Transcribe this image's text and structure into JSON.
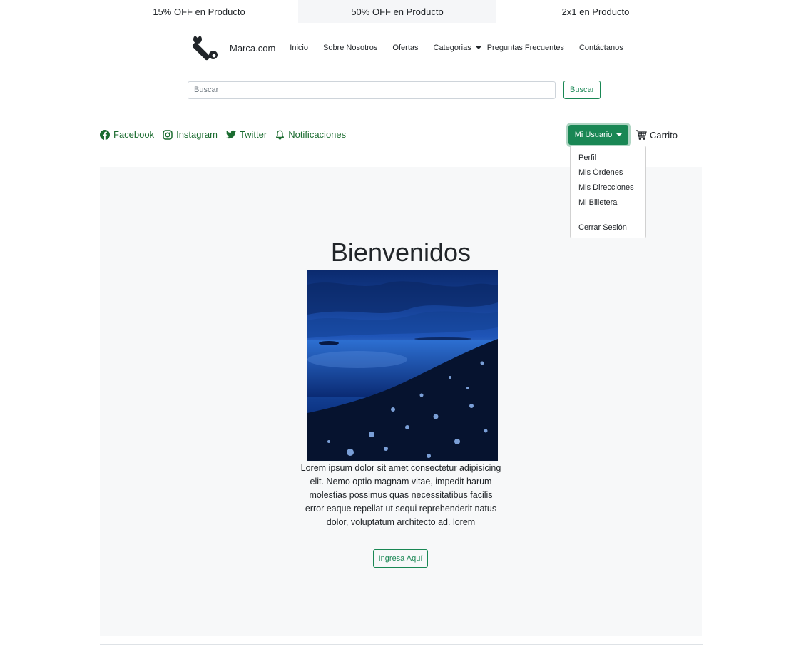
{
  "promo": {
    "items": [
      "15% OFF en Producto",
      "50% OFF en Producto",
      "2x1 en Producto"
    ]
  },
  "nav": {
    "brand": "Marca.com",
    "links": [
      "Inicio",
      "Sobre Nosotros",
      "Ofertas",
      "Categorias",
      "Preguntas Frecuentes",
      "Contáctanos"
    ]
  },
  "search": {
    "placeholder": "Buscar",
    "button": "Buscar"
  },
  "social": {
    "facebook": "Facebook",
    "instagram": "Instagram",
    "twitter": "Twitter",
    "notifications": "Notificaciones"
  },
  "user": {
    "button": "Mi Usuario",
    "cart": "Carrito",
    "menu": [
      "Perfil",
      "Mis Órdenes",
      "Mis Direcciones",
      "Mi Billetera"
    ],
    "logout": "Cerrar Sesión"
  },
  "hero": {
    "title": "Bienvenidos",
    "text": "Lorem ipsum dolor sit amet consectetur adipisicing elit. Nemo optio magnam vitae, impedit harum molestias possimus quas necessitatibus facilis error eaque repellat ut sequi reprehenderit natus dolor, voluptatum architecto ad. lorem",
    "button": "Ingresa Aquí"
  },
  "colors": {
    "accent": "#198754",
    "social_text": "#1a6b2f",
    "hero_bg": "#f7f8f9"
  },
  "icons": [
    "wrench-icon",
    "facebook-icon",
    "instagram-icon",
    "twitter-icon",
    "bell-icon",
    "cart-icon"
  ]
}
